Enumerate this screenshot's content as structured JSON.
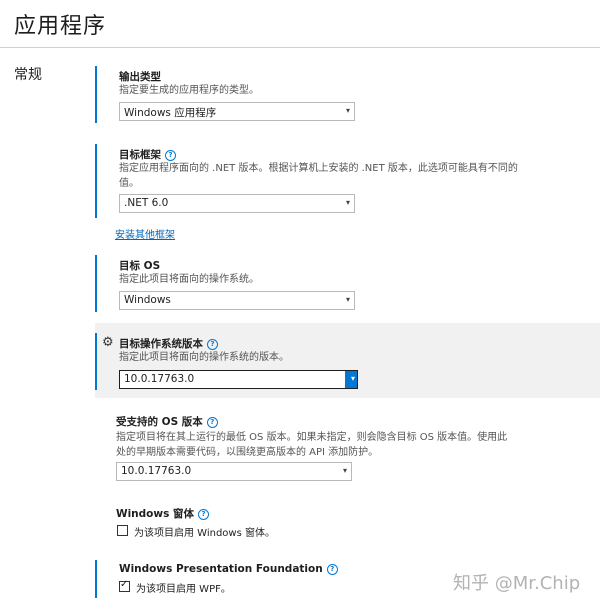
{
  "page": {
    "title": "应用程序",
    "category": "常规"
  },
  "output_type": {
    "title": "输出类型",
    "description": "指定要生成的应用程序的类型。",
    "value": "Windows 应用程序"
  },
  "target_framework": {
    "title": "目标框架",
    "description": "指定应用程序面向的 .NET 版本。根据计算机上安装的 .NET 版本，此选项可能具有不同的值。",
    "value": ".NET 6.0",
    "install_link": "安装其他框架"
  },
  "target_os": {
    "title": "目标 OS",
    "description": "指定此项目将面向的操作系统。",
    "value": "Windows"
  },
  "target_os_version": {
    "title": "目标操作系统版本",
    "description": "指定此项目将面向的操作系统的版本。",
    "value": "10.0.17763.0"
  },
  "supported_os_version": {
    "title": "受支持的 OS 版本",
    "description": "指定项目将在其上运行的最低 OS 版本。如果未指定，则会隐含目标 OS 版本值。使用此处的早期版本需要代码，以围绕更高版本的 API 添加防护。",
    "value": "10.0.17763.0"
  },
  "windows_forms": {
    "title": "Windows 窗体",
    "checkbox_label": "为该项目启用 Windows 窗体。",
    "checked": false
  },
  "wpf": {
    "title": "Windows Presentation Foundation",
    "checkbox_label": "为该项目启用 WPF。",
    "checked": true
  },
  "icons": {
    "help": "help-circle-icon",
    "gear": "gear-icon",
    "dropdown": "chevron-down-icon",
    "check": "checkmark-icon"
  },
  "colors": {
    "accent": "#0078d4",
    "link": "#0066b8",
    "highlight": "#f1f1f1"
  },
  "watermark": "知乎 @Mr.Chip"
}
